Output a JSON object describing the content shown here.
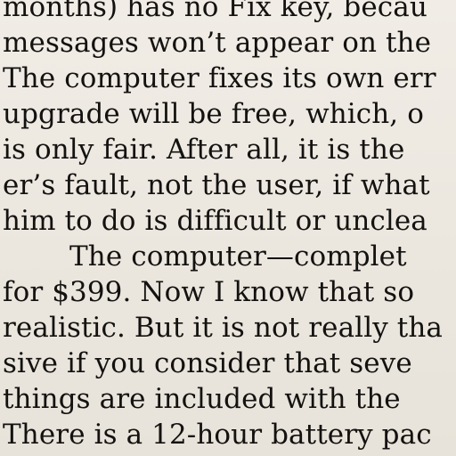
{
  "article": {
    "lines": [
      "months) has no Fix key, becau",
      "messages won’t appear on the",
      "The computer fixes its own err",
      "upgrade will be free, which, o",
      "is only fair. After all, it is the",
      "er’s fault, not the user, if what",
      "him to do is difficult or unclea",
      "The computer—complet",
      "for $399. Now I know that so",
      "realistic. But it is not really tha",
      "sive if you consider that seve",
      "things are included with the",
      "There is a 12-hour battery pac"
    ]
  }
}
